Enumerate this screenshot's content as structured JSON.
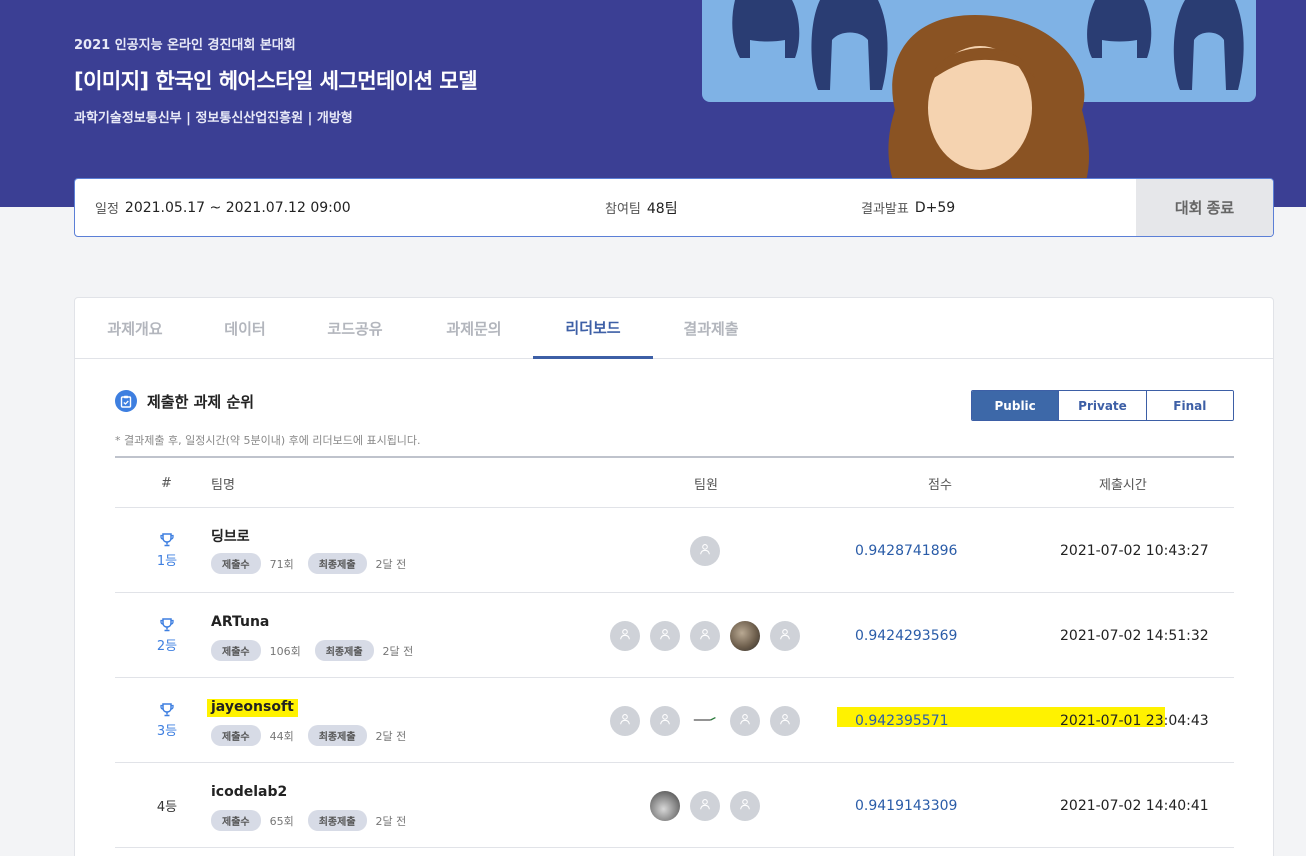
{
  "hero": {
    "subtitle": "2021 인공지능 온라인 경진대회 본대회",
    "title": "[이미지] 한국인 헤어스타일 세그먼테이션 모델",
    "meta": "과학기술정보통신부 | 정보통신산업진흥원 | 개방형"
  },
  "info": {
    "schedule_label": "일정",
    "schedule_value": "2021.05.17 ~ 2021.07.12 09:00",
    "teams_label": "참여팀",
    "teams_value": "48팀",
    "result_label": "결과발표",
    "result_value": "D+59",
    "status_button": "대회 종료"
  },
  "tabs": [
    "과제개요",
    "데이터",
    "코드공유",
    "과제문의",
    "리더보드",
    "결과제출"
  ],
  "active_tab": "리더보드",
  "section": {
    "title": "제출한 과제 순위",
    "note": "* 결과제출 후, 일정시간(약 5분이내) 후에 리더보드에 표시됩니다."
  },
  "board_toggle": [
    "Public",
    "Private",
    "Final"
  ],
  "board_active": "Public",
  "table": {
    "headers": {
      "rank": "#",
      "team": "팀명",
      "members": "팀원",
      "score": "점수",
      "time": "제출시간"
    },
    "badge_submissions": "제출수",
    "badge_final": "최종제출",
    "rows": [
      {
        "rank": "1등",
        "trophy": true,
        "team": "딩브로",
        "submissions": "71회",
        "final": "2달 전",
        "members": [
          "default"
        ],
        "score": "0.9428741896",
        "time": "2021-07-02 10:43:27",
        "highlight": false
      },
      {
        "rank": "2등",
        "trophy": true,
        "team": "ARTuna",
        "submissions": "106회",
        "final": "2달 전",
        "members": [
          "default",
          "default",
          "default",
          "photo",
          "default"
        ],
        "score": "0.9424293569",
        "time": "2021-07-02 14:51:32",
        "highlight": false
      },
      {
        "rank": "3등",
        "trophy": true,
        "team": "jayeonsoft",
        "submissions": "44회",
        "final": "2달 전",
        "members": [
          "default",
          "default",
          "logo",
          "default",
          "default"
        ],
        "score": "0.942395571",
        "time": "2021-07-01 23:04:43",
        "highlight": true
      },
      {
        "rank": "4등",
        "trophy": false,
        "team": "icodelab2",
        "submissions": "65회",
        "final": "2달 전",
        "members": [
          "photo2",
          "default",
          "default"
        ],
        "score": "0.9419143309",
        "time": "2021-07-02 14:40:41",
        "highlight": false
      }
    ]
  },
  "colors": {
    "hero_bg": "#3b3f94",
    "accent": "#3d5fa6",
    "score": "#2a5ca8",
    "highlight": "#fff200"
  },
  "icons": {
    "trophy": "trophy-icon",
    "clipboard": "clipboard-icon",
    "avatar_default": "user-icon"
  }
}
